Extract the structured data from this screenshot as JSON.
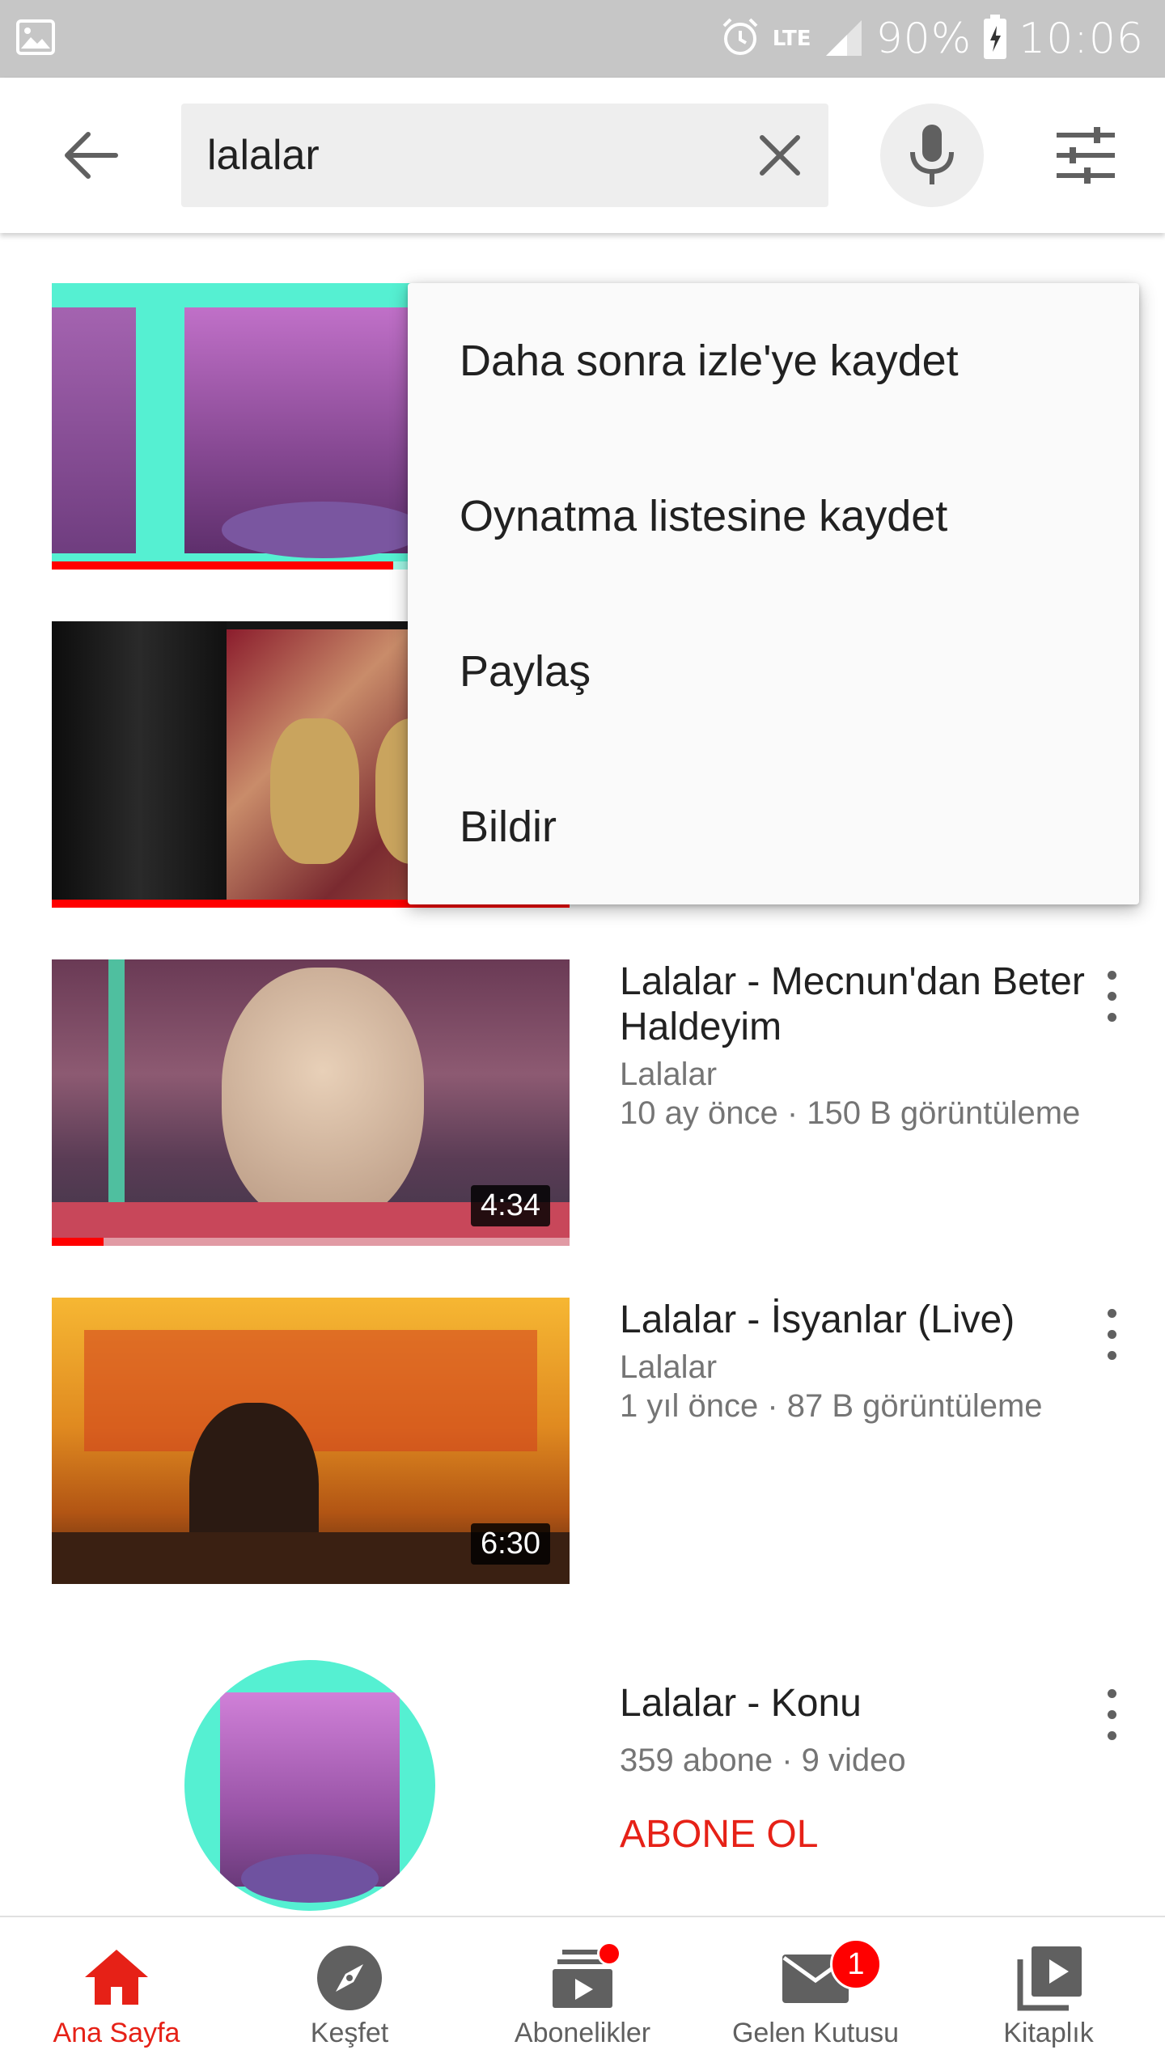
{
  "status_bar": {
    "network": "LTE",
    "battery": "90%",
    "time": "10:06"
  },
  "search": {
    "query": "lalalar"
  },
  "context_menu": {
    "items": [
      "Daha sonra izle'ye kaydet",
      "Oynatma listesine kaydet",
      "Paylaş",
      "Bildir"
    ]
  },
  "results": [
    {
      "progress_fraction": 0.66
    },
    {
      "progress_fraction": 1.0
    },
    {
      "title": "Lalalar - Mecnun'dan Beter Haldeyim",
      "channel": "Lalalar",
      "stats": "10 ay önce · 150 B görüntüleme",
      "duration": "4:34",
      "progress_fraction": 0.1
    },
    {
      "title": "Lalalar - İsyanlar (Live)",
      "channel": "Lalalar",
      "stats": "1 yıl önce · 87 B görüntüleme",
      "duration": "6:30",
      "progress_fraction": 0
    }
  ],
  "channel_result": {
    "title": "Lalalar - Konu",
    "stats": "359 abone · 9 video",
    "subscribe_label": "ABONE OL"
  },
  "bottom_nav": {
    "items": [
      {
        "label": "Ana Sayfa",
        "icon": "home-icon",
        "active": true
      },
      {
        "label": "Keşfet",
        "icon": "compass-icon",
        "active": false
      },
      {
        "label": "Abonelikler",
        "icon": "subscriptions-icon",
        "active": false
      },
      {
        "label": "Gelen Kutusu",
        "icon": "inbox-icon",
        "active": false,
        "badge": "1"
      },
      {
        "label": "Kitaplık",
        "icon": "library-icon",
        "active": false
      }
    ]
  },
  "colors": {
    "accent_red": "#e62117",
    "progress_red": "#ff0000",
    "status_bar": "#c6c6c6",
    "thumb_teal": "#55f0d2",
    "thumb_purple": "#9b4fa8"
  }
}
